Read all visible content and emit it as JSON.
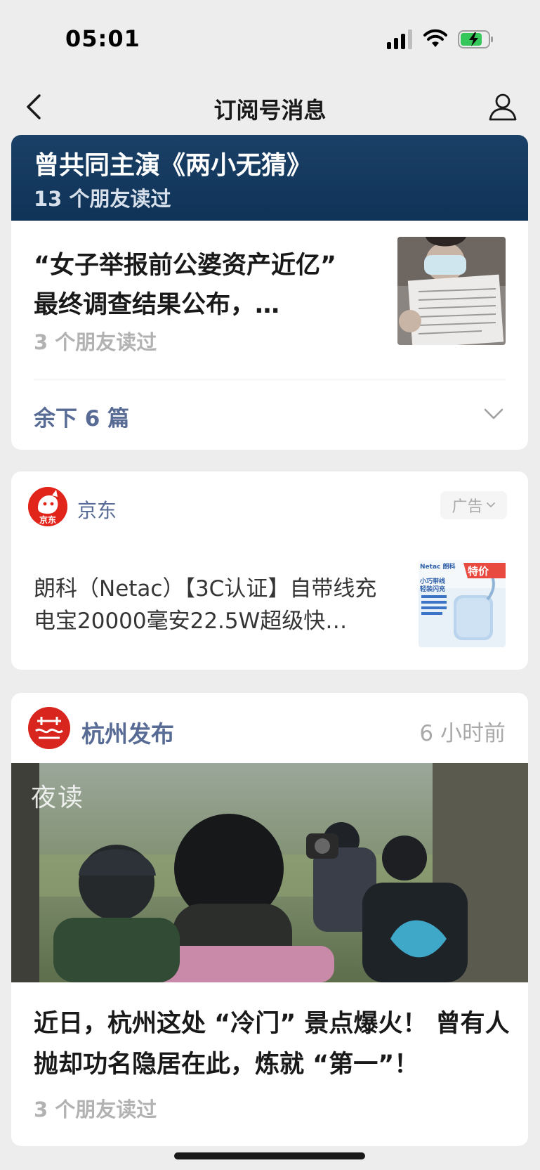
{
  "status_bar": {
    "time": "05:01"
  },
  "nav": {
    "title": "订阅号消息"
  },
  "card_main": {
    "banner_title": "曾共同主演《两小无猜》",
    "banner_reads": "13 个朋友读过",
    "article_title": "“女子举报前公婆资产近亿” 最终调查结果公布，…",
    "article_reads": "3 个朋友读过",
    "remaining_label": "余下 6 篇"
  },
  "ad_card": {
    "advertiser": "京东",
    "jd_logo_text": "京东",
    "ad_badge": "广告",
    "ad_text": "朗科（Netac）【3C认证】自带线充电宝20000毫安22.5W超级快…",
    "thumb_brand": "Netac 朗科",
    "thumb_sale": "特价",
    "thumb_caption": "小巧带线 轻装闪充"
  },
  "hangzhou_card": {
    "account": "杭州发布",
    "time": "6 小时前",
    "hero_overlay": "夜读",
    "article_title": "近日，杭州这处 “冷门” 景点爆火！ 曾有人抛却功名隐居在此，炼就 “第一”！",
    "article_reads": "3 个朋友读过"
  },
  "colors": {
    "link_blue": "#576b95",
    "banner_navy": "#10365a",
    "jd_red": "#e1251b",
    "hz_red": "#d8251e",
    "muted_gray": "#b2b2b2"
  },
  "icons": [
    "back-arrow-icon",
    "profile-icon",
    "chevron-down-icon",
    "signal-icon",
    "wifi-icon",
    "battery-charging-icon"
  ]
}
